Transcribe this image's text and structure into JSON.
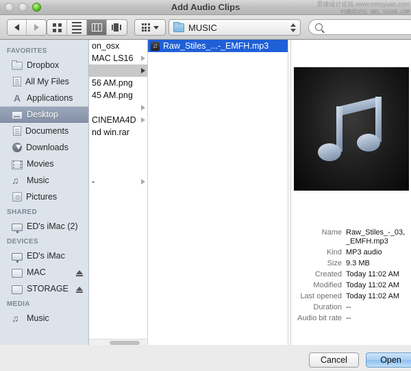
{
  "window": {
    "title": "Add Audio Clips",
    "traffic": {
      "close": "close-button",
      "minimize": "minimize-button",
      "zoom": "zoom-button"
    },
    "watermark_line1": "思缘设计论坛  www.missyuan.com",
    "watermark_line2": "PS教程论坛  BBS.16XX8.COM"
  },
  "toolbar": {
    "back": "back-arrow-icon",
    "forward": "forward-arrow-icon",
    "views": [
      {
        "name": "icon-view",
        "icon": "grid-icon",
        "active": false
      },
      {
        "name": "list-view",
        "icon": "list-icon",
        "active": false
      },
      {
        "name": "column-view",
        "icon": "columns-icon",
        "active": true
      },
      {
        "name": "coverflow-view",
        "icon": "coverflow-icon",
        "active": false
      }
    ],
    "arrange": {
      "icon": "arrange-grid-icon",
      "caret": "chevron-down-icon"
    },
    "path_popup": {
      "icon": "folder-icon",
      "label": "MUSIC",
      "stepper": "up-down-stepper-icon"
    },
    "search": {
      "icon": "search-icon",
      "value": "",
      "placeholder": ""
    }
  },
  "sidebar": {
    "sections": [
      {
        "title": "FAVORITES",
        "items": [
          {
            "label": "Dropbox",
            "icon": "folder-icon",
            "selected": false,
            "eject": false
          },
          {
            "label": "All My Files",
            "icon": "all-my-files-icon",
            "selected": false,
            "eject": false
          },
          {
            "label": "Applications",
            "icon": "applications-icon",
            "selected": false,
            "eject": false
          },
          {
            "label": "Desktop",
            "icon": "desktop-icon",
            "selected": true,
            "eject": false
          },
          {
            "label": "Documents",
            "icon": "documents-icon",
            "selected": false,
            "eject": false
          },
          {
            "label": "Downloads",
            "icon": "downloads-icon",
            "selected": false,
            "eject": false
          },
          {
            "label": "Movies",
            "icon": "movies-icon",
            "selected": false,
            "eject": false
          },
          {
            "label": "Music",
            "icon": "music-note-icon",
            "selected": false,
            "eject": false
          },
          {
            "label": "Pictures",
            "icon": "pictures-icon",
            "selected": false,
            "eject": false
          }
        ]
      },
      {
        "title": "SHARED",
        "items": [
          {
            "label": "ED's iMac (2)",
            "icon": "imac-icon",
            "selected": false,
            "eject": false
          }
        ]
      },
      {
        "title": "DEVICES",
        "items": [
          {
            "label": "ED's iMac",
            "icon": "imac-icon",
            "selected": false,
            "eject": false
          },
          {
            "label": "MAC",
            "icon": "harddisk-icon",
            "selected": false,
            "eject": true
          },
          {
            "label": "STORAGE",
            "icon": "harddisk-icon",
            "selected": false,
            "eject": true
          }
        ]
      },
      {
        "title": "MEDIA",
        "items": [
          {
            "label": "Music",
            "icon": "music-note-icon",
            "selected": false,
            "eject": false
          }
        ]
      }
    ]
  },
  "columns": [
    {
      "name": "column-one",
      "scrolled": true,
      "rows": [
        {
          "label": "on_osx",
          "state": "normal",
          "disclosure": false,
          "icon": null
        },
        {
          "label": "MAC LS16",
          "state": "normal",
          "disclosure": true,
          "icon": null
        },
        {
          "label": "",
          "state": "selected",
          "disclosure": true,
          "icon": null
        },
        {
          "label": "56 AM.png",
          "state": "normal",
          "disclosure": false,
          "icon": null
        },
        {
          "label": "45 AM.png",
          "state": "normal",
          "disclosure": false,
          "icon": null
        },
        {
          "label": "",
          "state": "normal",
          "disclosure": true,
          "icon": null
        },
        {
          "label": "CINEMA4D",
          "state": "normal",
          "disclosure": true,
          "icon": null
        },
        {
          "label": "nd win.rar",
          "state": "normal",
          "disclosure": false,
          "icon": null
        },
        {
          "label": "",
          "state": "normal",
          "disclosure": false,
          "icon": null
        },
        {
          "label": "",
          "state": "normal",
          "disclosure": false,
          "icon": null
        },
        {
          "label": "",
          "state": "normal",
          "disclosure": false,
          "icon": null
        },
        {
          "label": "-",
          "state": "normal",
          "disclosure": true,
          "icon": null
        }
      ]
    },
    {
      "name": "column-two",
      "scrolled": false,
      "rows": [
        {
          "label": "Raw_Stiles_...-_EMFH.mp3",
          "state": "highlighted",
          "disclosure": false,
          "icon": "mp3-file-icon"
        }
      ]
    }
  ],
  "preview": {
    "artwork": {
      "name": "album-artwork",
      "icon": "music-note-icon"
    },
    "fields": [
      {
        "key": "Name",
        "value": "Raw_Stiles_-_03,\n_EMFH.mp3"
      },
      {
        "key": "Kind",
        "value": "MP3 audio"
      },
      {
        "key": "Size",
        "value": "9.3 MB"
      },
      {
        "key": "Created",
        "value": "Today 11:02 AM"
      },
      {
        "key": "Modified",
        "value": "Today 11:02 AM"
      },
      {
        "key": "Last opened",
        "value": "Today 11:02 AM"
      },
      {
        "key": "Duration",
        "value": "--"
      },
      {
        "key": "Audio bit rate",
        "value": "--"
      }
    ]
  },
  "footer": {
    "cancel_label": "Cancel",
    "open_label": "Open"
  },
  "colors": {
    "selection_blue": "#1f5fd8",
    "default_button_blue": "#a7cff4",
    "sidebar_bg": "#dde3ea",
    "sidebar_selected": "#8592a8"
  }
}
